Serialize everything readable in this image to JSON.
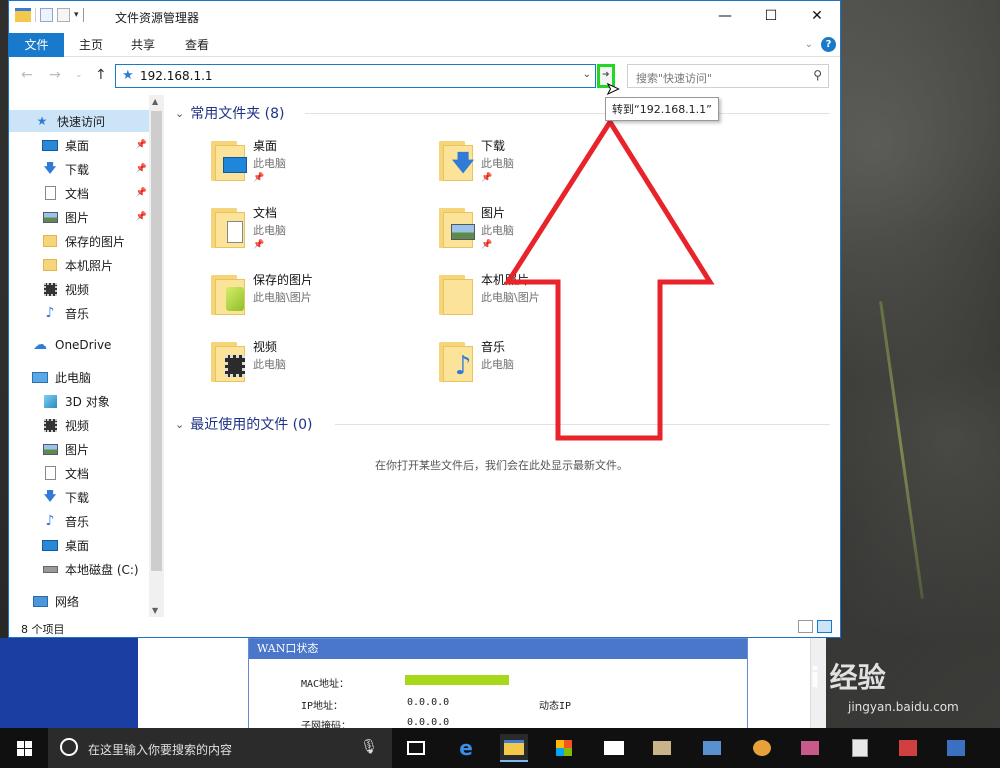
{
  "window": {
    "title": "文件资源管理器",
    "controls": {
      "minimize": "—",
      "maximize": "☐",
      "close": "✕"
    }
  },
  "ribbon": {
    "tabs": [
      {
        "label": "文件"
      },
      {
        "label": "主页"
      },
      {
        "label": "共享"
      },
      {
        "label": "查看"
      }
    ],
    "collapse_icon": "chevron-down-icon",
    "help": "?"
  },
  "nav": {
    "address": "192.168.1.1",
    "goto_tooltip": "转到“192.168.1.1”",
    "search_placeholder": "搜索\"快速访问\""
  },
  "sidebar": {
    "items": [
      {
        "label": "快速访问",
        "icon": "star-icon",
        "selected": true,
        "pinned": false
      },
      {
        "label": "桌面",
        "icon": "desktop-icon",
        "pinned": true
      },
      {
        "label": "下载",
        "icon": "download-icon",
        "pinned": true
      },
      {
        "label": "文档",
        "icon": "document-icon",
        "pinned": true
      },
      {
        "label": "图片",
        "icon": "picture-icon",
        "pinned": true
      },
      {
        "label": "保存的图片",
        "icon": "folder-icon",
        "pinned": false
      },
      {
        "label": "本机照片",
        "icon": "folder-icon",
        "pinned": false
      },
      {
        "label": "视频",
        "icon": "video-icon",
        "pinned": false
      },
      {
        "label": "音乐",
        "icon": "music-icon",
        "pinned": false
      },
      {
        "label": "OneDrive",
        "icon": "cloud-icon",
        "pinned": false
      },
      {
        "label": "此电脑",
        "icon": "computer-icon",
        "pinned": false
      },
      {
        "label": "3D 对象",
        "icon": "cube-icon",
        "pinned": false
      },
      {
        "label": "视频",
        "icon": "video-icon",
        "pinned": false
      },
      {
        "label": "图片",
        "icon": "picture-icon",
        "pinned": false
      },
      {
        "label": "文档",
        "icon": "document-icon",
        "pinned": false
      },
      {
        "label": "下载",
        "icon": "download-icon",
        "pinned": false
      },
      {
        "label": "音乐",
        "icon": "music-icon",
        "pinned": false
      },
      {
        "label": "桌面",
        "icon": "desktop-icon",
        "pinned": false
      },
      {
        "label": "本地磁盘 (C:)",
        "icon": "drive-icon",
        "pinned": false
      },
      {
        "label": "网络",
        "icon": "network-icon",
        "pinned": false
      }
    ]
  },
  "content": {
    "frequent_header": "常用文件夹 (8)",
    "recent_header": "最近使用的文件 (0)",
    "empty_message": "在你打开某些文件后，我们会在此处显示最新文件。",
    "folders": [
      {
        "name": "桌面",
        "location": "此电脑",
        "pinned": true,
        "badge": "desktop"
      },
      {
        "name": "下载",
        "location": "此电脑",
        "pinned": true,
        "badge": "download"
      },
      {
        "name": "文档",
        "location": "此电脑",
        "pinned": true,
        "badge": "document"
      },
      {
        "name": "图片",
        "location": "此电脑",
        "pinned": true,
        "badge": "picture"
      },
      {
        "name": "保存的图片",
        "location": "此电脑\\图片",
        "pinned": false,
        "badge": "saved"
      },
      {
        "name": "本机照片",
        "location": "此电脑\\图片",
        "pinned": false,
        "badge": "none"
      },
      {
        "name": "视频",
        "location": "此电脑",
        "pinned": false,
        "badge": "video"
      },
      {
        "name": "音乐",
        "location": "此电脑",
        "pinned": false,
        "badge": "music"
      }
    ]
  },
  "status": {
    "count": "8 个项目"
  },
  "router": {
    "panel_title": "WAN口状态",
    "rows": [
      {
        "label": "MAC地址：",
        "value": ""
      },
      {
        "label": "IP地址：",
        "value": "0.0.0.0",
        "mode": "动态IP"
      },
      {
        "label": "子网掩码：",
        "value": "0.0.0.0"
      }
    ]
  },
  "taskbar": {
    "search_placeholder": "在这里输入你要搜索的内容"
  },
  "watermark": {
    "main": "Bai 经验",
    "sub": "jingyan.baidu.com"
  },
  "colors": {
    "accent": "#1979ca",
    "highlight": "#22d822",
    "arrow": "#e8232a",
    "selection": "#cce4f7"
  }
}
